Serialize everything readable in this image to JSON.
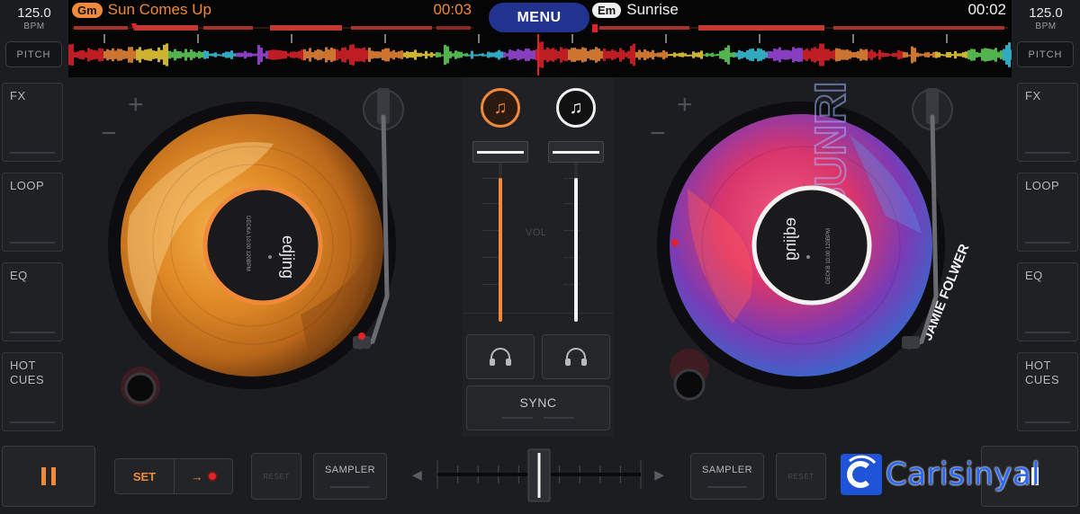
{
  "app": {
    "menu_label": "MENU"
  },
  "deck_left": {
    "bpm": "125.0",
    "bpm_unit": "BPM",
    "pitch_label": "PITCH",
    "key": "Gm",
    "title": "Sun Comes Up",
    "time": "00:03",
    "accent": "#f08a3a",
    "label_brand": "edjing",
    "label_code": "DECKA 10:00 120BPM"
  },
  "deck_right": {
    "bpm": "125.0",
    "bpm_unit": "BPM",
    "pitch_label": "PITCH",
    "key": "Em",
    "title": "Sunrise",
    "time": "00:02",
    "accent": "#f2f2f2",
    "label_brand": "edjing",
    "label_code": "DECKB 10:00 120BPM",
    "artist_print": "JAMIE FOLWER",
    "title_print": "SUNRISE"
  },
  "left_panel": {
    "items": [
      "FX",
      "LOOP",
      "EQ",
      "HOT CUES"
    ]
  },
  "right_panel": {
    "items": [
      "FX",
      "LOOP",
      "EQ",
      "HOT CUES"
    ]
  },
  "mixer": {
    "vol_label": "VOL",
    "sync_label": "SYNC",
    "left_volume": 1.0,
    "right_volume": 1.0
  },
  "bottom": {
    "set_label": "SET",
    "reset_label": "RESET",
    "sampler_label": "SAMPLER",
    "crossfader_position": 0.5
  },
  "watermark": {
    "text": "Carisinyal"
  },
  "icons": {
    "pause": "pause-icon",
    "headphones": "headphones-icon",
    "music_note": "music-note-icon",
    "arrow_right": "arrow-right-icon",
    "record": "record-dot-icon"
  },
  "colors": {
    "left_accent": "#f08a3a",
    "right_accent": "#f2f2f2",
    "menu": "#21338f",
    "cue_red": "#e0222a"
  }
}
